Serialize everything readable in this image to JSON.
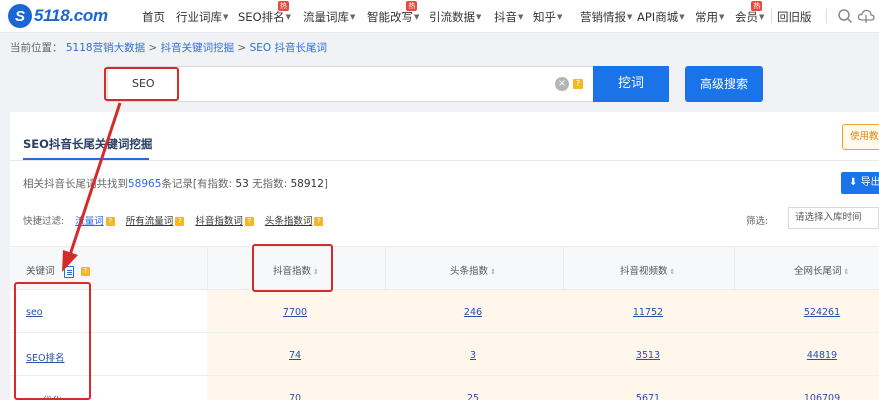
{
  "brand": {
    "logo_mark": "S",
    "logo_text": "5118.com",
    "accent": "#1a73e8",
    "annotation_color": "#d42b2b"
  },
  "nav": [
    {
      "label": "首页",
      "caret": false
    },
    {
      "label": "行业词库",
      "caret": true
    },
    {
      "label": "SEO排名",
      "caret": true,
      "hot": "热"
    },
    {
      "label": "流量词库",
      "caret": true
    },
    {
      "label": "智能改写",
      "caret": true,
      "hot": "热"
    },
    {
      "label": "引流数据",
      "caret": true
    },
    {
      "label": "抖音",
      "caret": true
    },
    {
      "label": "知乎",
      "caret": true
    },
    {
      "label": "营销情报",
      "caret": true
    },
    {
      "label": "API商城",
      "caret": true
    },
    {
      "label": "常用",
      "caret": true
    },
    {
      "label": "会员",
      "caret": true,
      "hot": "热"
    },
    {
      "label": "回旧版",
      "caret": false
    }
  ],
  "nav_icons": [
    "search-icon",
    "cloud-icon"
  ],
  "breadcrumb": {
    "prefix": "当前位置：",
    "items": [
      "5118营销大数据",
      "抖音关键词挖掘",
      "SEO 抖音长尾词"
    ],
    "separator": ">"
  },
  "search": {
    "value": "SEO",
    "clear": "×",
    "help": "?",
    "submit_label": "挖词",
    "advanced_label": "高级搜索"
  },
  "panel": {
    "title": "SEO抖音长尾关键词挖掘",
    "use_tip": "使用教程",
    "stats": {
      "before": "相关抖音长尾词共找到",
      "total": "58965",
      "mid": "条记录[有指数:",
      "with_index": "53",
      "mid2": "无指数:",
      "without_index": "58912",
      "after": "]"
    },
    "export_label": "导出",
    "filter": {
      "label": "快捷过滤:",
      "options": [
        "流量词",
        "所有流量词",
        "抖音指数词",
        "头条指数词"
      ],
      "active_index": 0,
      "right_label": "筛选:",
      "right_placeholder": "请选择入库时间"
    }
  },
  "table": {
    "columns": [
      "关键词",
      "抖音指数",
      "头条指数",
      "抖音视频数",
      "全网长尾词"
    ],
    "rows": [
      [
        "seo",
        "7700",
        "246",
        "11752",
        "524261"
      ],
      [
        "SEO排名",
        "74",
        "3",
        "3513",
        "44819"
      ],
      [
        "seo优化",
        "70",
        "25",
        "5671",
        "106709"
      ]
    ]
  }
}
